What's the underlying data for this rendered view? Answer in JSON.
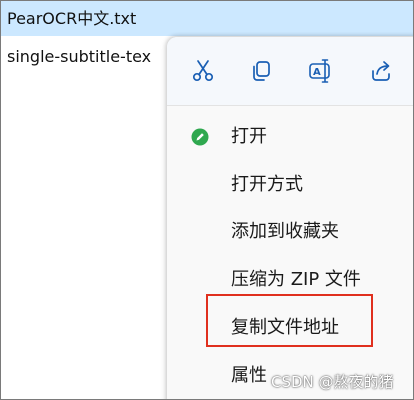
{
  "files": [
    {
      "name": "PearOCR中文.txt",
      "selected": true
    },
    {
      "name": "single-subtitle-tex",
      "selected": false
    }
  ],
  "context_menu": {
    "toolbar": [
      {
        "icon": "scissors-icon",
        "action": "cut"
      },
      {
        "icon": "copy-icon",
        "action": "copy"
      },
      {
        "icon": "rename-icon",
        "action": "rename"
      },
      {
        "icon": "share-icon",
        "action": "share"
      }
    ],
    "items": [
      {
        "label": "打开",
        "icon": "open-green-icon"
      },
      {
        "label": "打开方式"
      },
      {
        "label": "添加到收藏夹"
      },
      {
        "label": "压缩为 ZIP 文件"
      },
      {
        "label": "复制文件地址",
        "highlighted": true
      },
      {
        "label": "属性"
      }
    ]
  },
  "watermark": "CSDN @熬夜的猪",
  "colors": {
    "selection": "#cce8ff",
    "accent": "#1a5fb4",
    "open_icon": "#2fa84f",
    "highlight_border": "#e0301e"
  }
}
